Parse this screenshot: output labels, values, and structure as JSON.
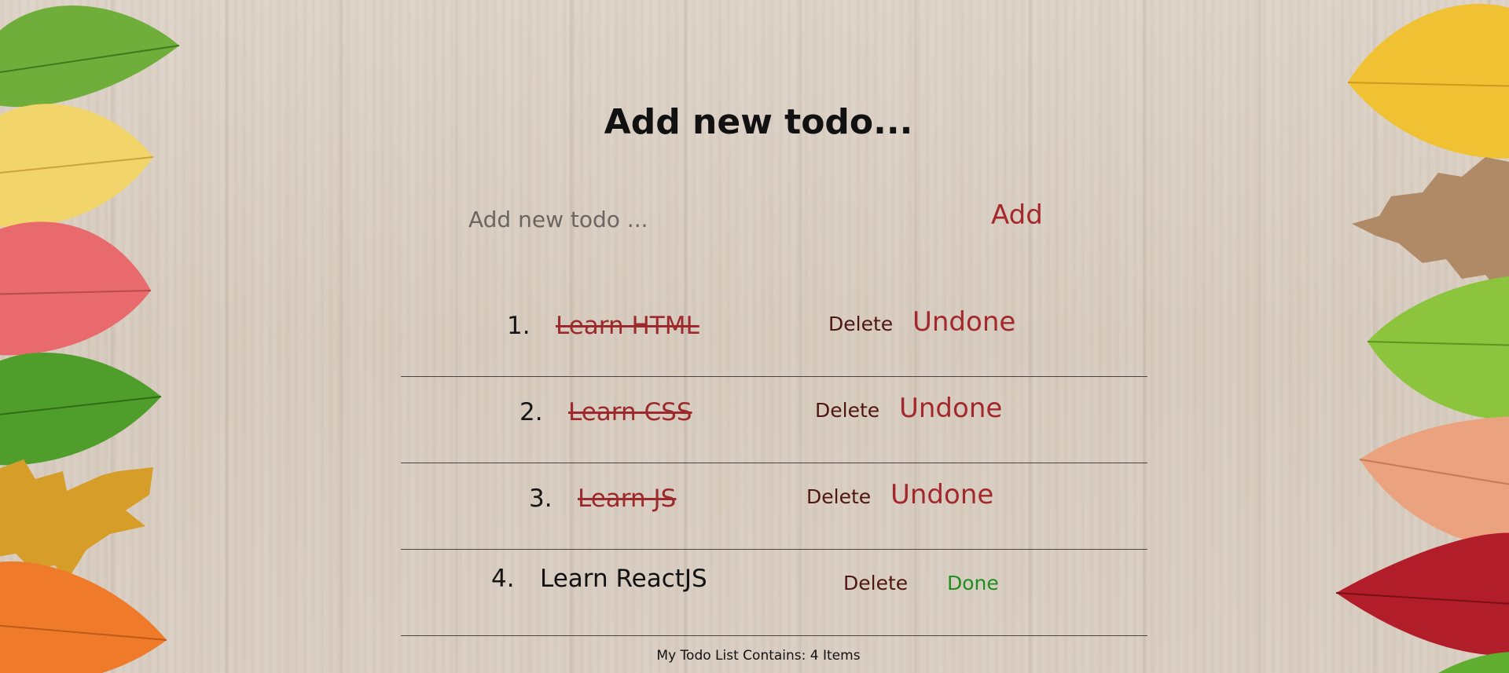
{
  "header": {
    "title": "Add new todo..."
  },
  "add_form": {
    "placeholder": "Add new todo ...",
    "value": "",
    "add_label": "Add"
  },
  "todos": [
    {
      "number": "1.",
      "text": "Learn HTML",
      "completed": true,
      "delete_label": "Delete",
      "toggle_label": "Undone"
    },
    {
      "number": "2.",
      "text": "Learn CSS",
      "completed": true,
      "delete_label": "Delete",
      "toggle_label": "Undone"
    },
    {
      "number": "3.",
      "text": "Learn JS",
      "completed": true,
      "delete_label": "Delete",
      "toggle_label": "Undone"
    },
    {
      "number": "4.",
      "text": "Learn ReactJS",
      "completed": false,
      "delete_label": "Delete",
      "toggle_label": "Done"
    }
  ],
  "footer": {
    "summary": "My Todo List Contains: 4 Items"
  },
  "colors": {
    "accent_red": "#a3282b",
    "done_green": "#1e8e1e",
    "delete_dark_red": "#4f1515"
  },
  "icons": {
    "left_decoration": "autumn-leaves",
    "right_decoration": "autumn-leaves"
  }
}
